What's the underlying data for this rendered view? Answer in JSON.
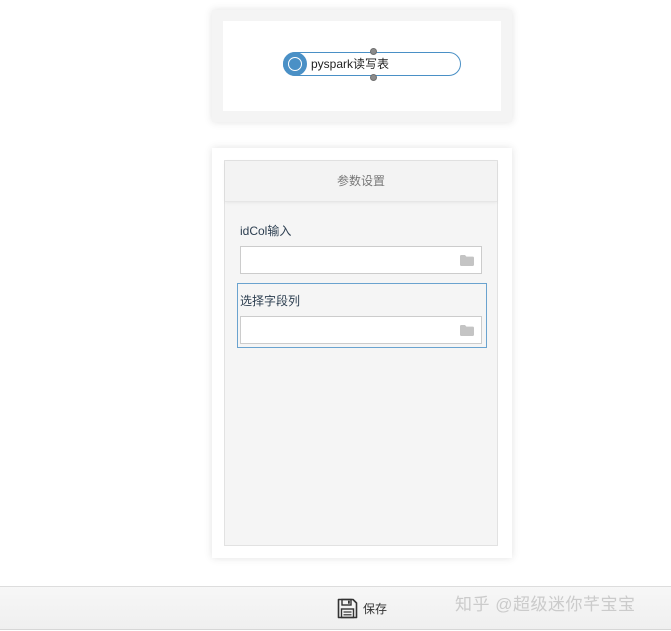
{
  "canvas": {
    "node": {
      "label": "pyspark读写表",
      "icon": "node-circle-icon",
      "color": "#4a90c6"
    }
  },
  "panel": {
    "title": "参数设置",
    "fields": [
      {
        "label": "idCol输入",
        "value": "",
        "icon": "folder-icon"
      },
      {
        "label": "选择字段列",
        "value": "",
        "icon": "folder-icon"
      }
    ]
  },
  "toolbar": {
    "save_label": "保存",
    "save_icon": "floppy-disk-icon"
  },
  "watermark": {
    "text": "知乎 @超级迷你芊宝宝"
  },
  "colors": {
    "accent": "#4a90c6",
    "border": "#cccccc",
    "panel_bg": "#f5f5f5"
  }
}
